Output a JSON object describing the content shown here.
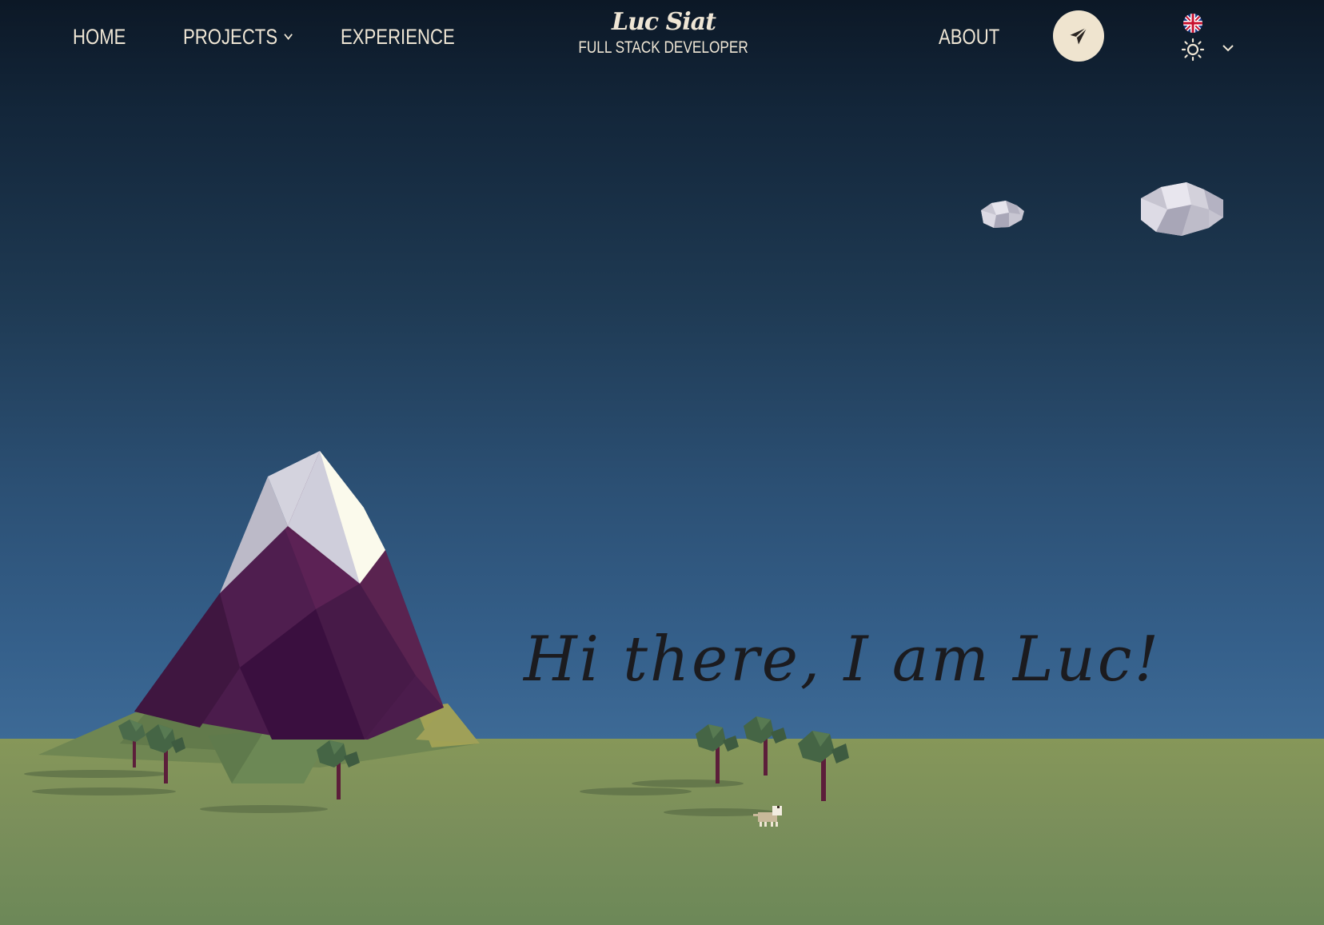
{
  "header": {
    "nav": {
      "home": "HOME",
      "projects": "PROJECTS",
      "experience": "EXPERIENCE",
      "about": "ABOUT"
    },
    "brand": {
      "name": "Luc Siat",
      "title": "FULL STACK DEVELOPER"
    },
    "contact_button_icon": "paper-plane-icon",
    "language_icon": "uk-flag-icon",
    "theme_icon": "sun-icon",
    "theme_dropdown_icon": "chevron-down-icon"
  },
  "hero": {
    "greeting": "Hi there, I am Luc!"
  },
  "colors": {
    "text_light": "#efe6d5",
    "button_bg": "#efe4cf",
    "sky_top": "#0c1826",
    "sky_bottom": "#3d6a96",
    "ground": "#869759",
    "mountain": "#4a1d4a"
  }
}
